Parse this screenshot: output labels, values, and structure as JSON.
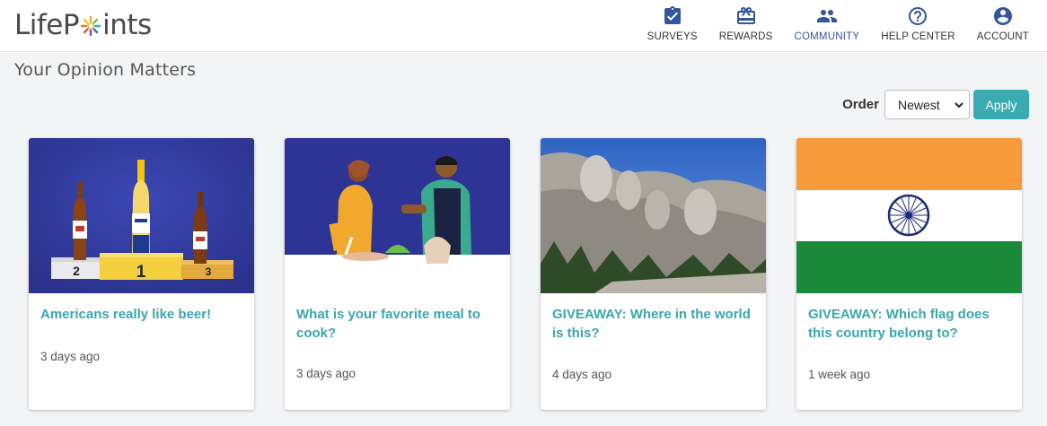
{
  "brand": {
    "logo_text_left": "LifeP",
    "logo_text_right": "ints"
  },
  "nav": [
    {
      "label": "SURVEYS",
      "icon": "clipboard-check-icon"
    },
    {
      "label": "REWARDS",
      "icon": "gift-icon"
    },
    {
      "label": "COMMUNITY",
      "icon": "people-icon"
    },
    {
      "label": "HELP CENTER",
      "icon": "question-circle-icon"
    },
    {
      "label": "ACCOUNT",
      "icon": "account-circle-icon"
    }
  ],
  "page": {
    "title": "Your Opinion Matters"
  },
  "order": {
    "label": "Order",
    "selected": "Newest",
    "apply_label": "Apply"
  },
  "cards": [
    {
      "title": "Americans really like beer!",
      "time": "3 days ago",
      "image": "beer-podium-illustration"
    },
    {
      "title": "What is your favorite meal to cook?",
      "time": "3 days ago",
      "image": "cooking-illustration"
    },
    {
      "title": "GIVEAWAY: Where in the world is this?",
      "time": "4 days ago",
      "image": "mount-rushmore-photo"
    },
    {
      "title": "GIVEAWAY: Which flag does this country belong to?",
      "time": "1 week ago",
      "image": "india-flag"
    }
  ],
  "colors": {
    "accent": "#3aacb1",
    "title_link": "#3aa6ad",
    "nav_icon": "#34569a",
    "illustration_bg": "#2d3494"
  }
}
